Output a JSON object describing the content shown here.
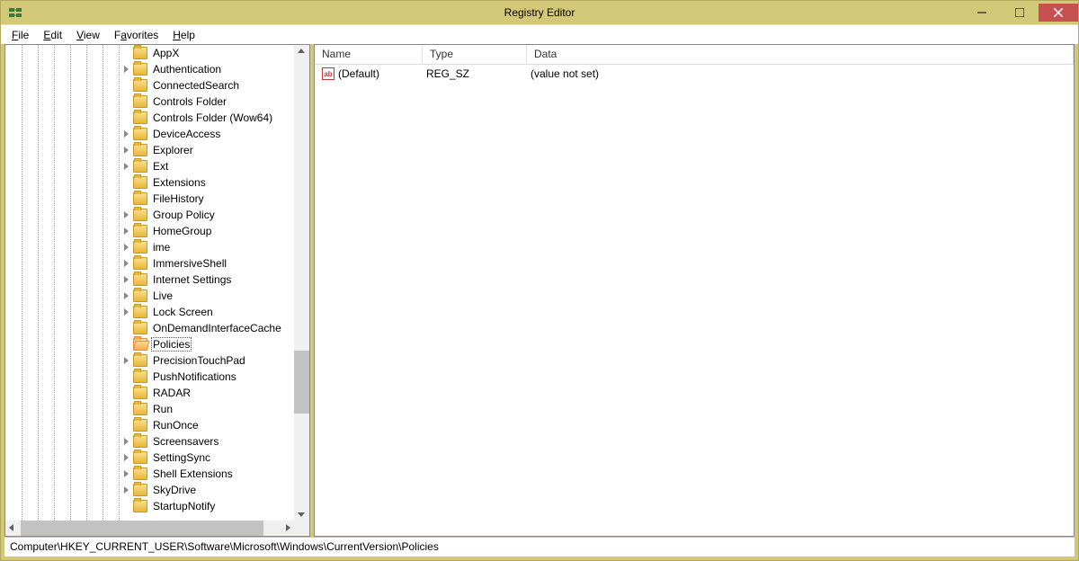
{
  "window": {
    "title": "Registry Editor"
  },
  "menubar": {
    "file": "File",
    "edit": "Edit",
    "view": "View",
    "favorites": "Favorites",
    "help": "Help"
  },
  "tree": {
    "items": [
      {
        "label": "AppX",
        "expandable": false
      },
      {
        "label": "Authentication",
        "expandable": true
      },
      {
        "label": "ConnectedSearch",
        "expandable": false
      },
      {
        "label": "Controls Folder",
        "expandable": false
      },
      {
        "label": "Controls Folder (Wow64)",
        "expandable": false
      },
      {
        "label": "DeviceAccess",
        "expandable": true
      },
      {
        "label": "Explorer",
        "expandable": true
      },
      {
        "label": "Ext",
        "expandable": true
      },
      {
        "label": "Extensions",
        "expandable": false
      },
      {
        "label": "FileHistory",
        "expandable": false
      },
      {
        "label": "Group Policy",
        "expandable": true
      },
      {
        "label": "HomeGroup",
        "expandable": true
      },
      {
        "label": "ime",
        "expandable": true
      },
      {
        "label": "ImmersiveShell",
        "expandable": true
      },
      {
        "label": "Internet Settings",
        "expandable": true
      },
      {
        "label": "Live",
        "expandable": true
      },
      {
        "label": "Lock Screen",
        "expandable": true
      },
      {
        "label": "OnDemandInterfaceCache",
        "expandable": false
      },
      {
        "label": "Policies",
        "expandable": false,
        "selected": true
      },
      {
        "label": "PrecisionTouchPad",
        "expandable": true
      },
      {
        "label": "PushNotifications",
        "expandable": false
      },
      {
        "label": "RADAR",
        "expandable": false
      },
      {
        "label": "Run",
        "expandable": false
      },
      {
        "label": "RunOnce",
        "expandable": false
      },
      {
        "label": "Screensavers",
        "expandable": true
      },
      {
        "label": "SettingSync",
        "expandable": true
      },
      {
        "label": "Shell Extensions",
        "expandable": true
      },
      {
        "label": "SkyDrive",
        "expandable": true
      },
      {
        "label": "StartupNotify",
        "expandable": false
      }
    ]
  },
  "list": {
    "headers": {
      "name": "Name",
      "type": "Type",
      "data": "Data"
    },
    "rows": [
      {
        "name": "(Default)",
        "type": "REG_SZ",
        "data": "(value not set)"
      }
    ]
  },
  "statusbar": {
    "path": "Computer\\HKEY_CURRENT_USER\\Software\\Microsoft\\Windows\\CurrentVersion\\Policies"
  }
}
